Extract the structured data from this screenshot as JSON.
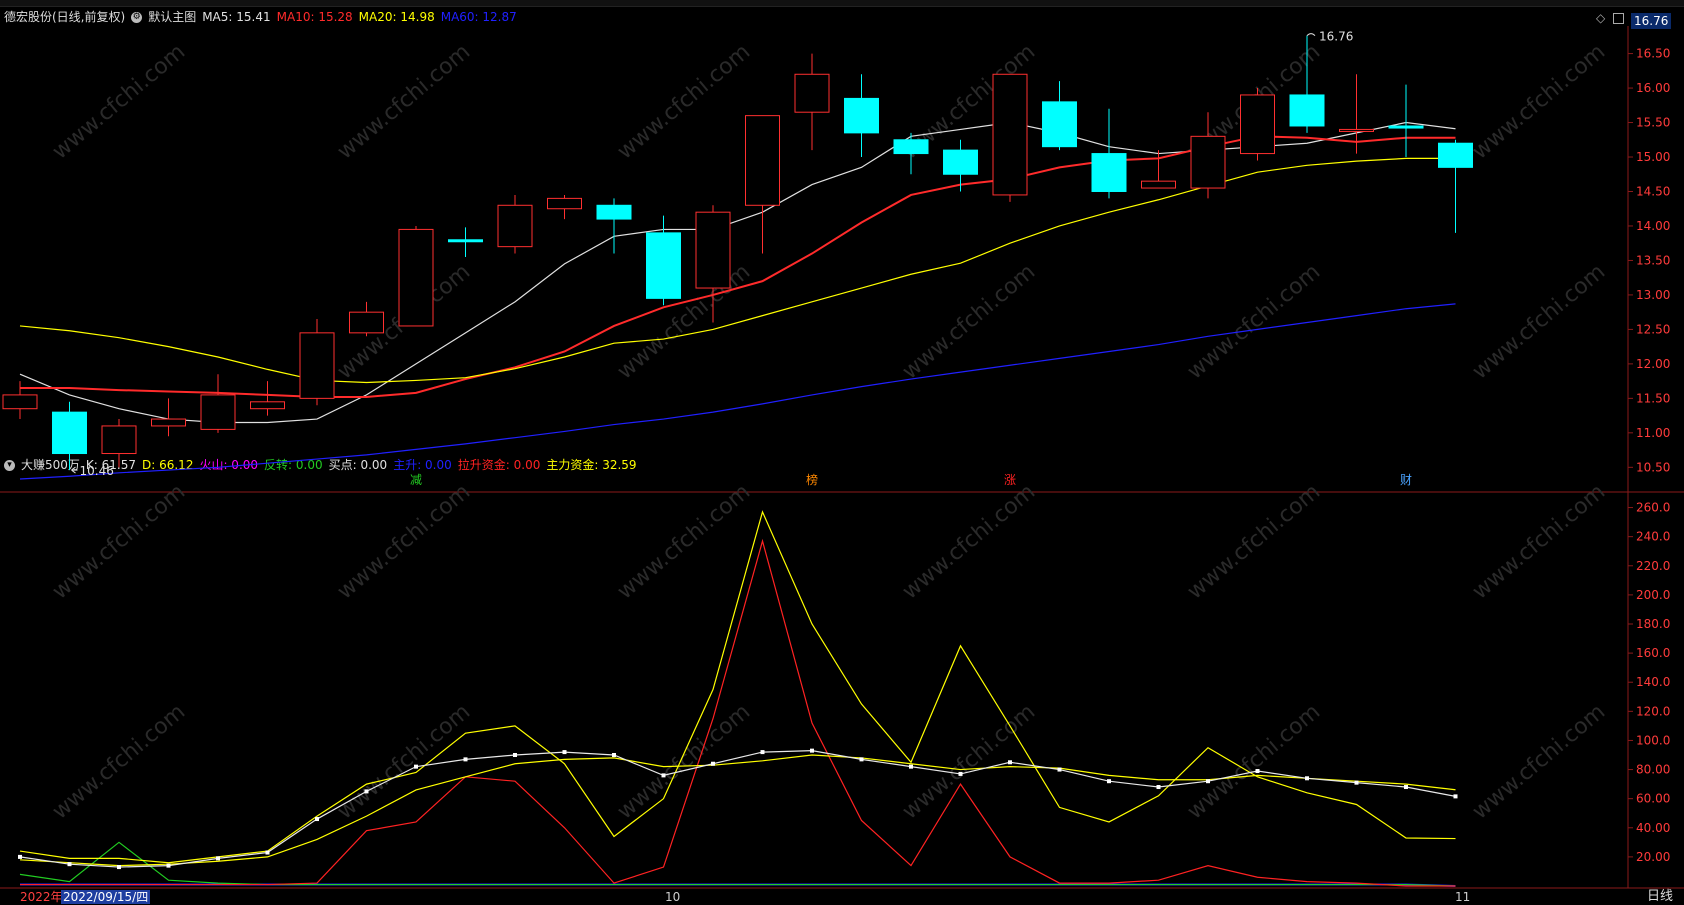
{
  "stock_title": "德宏股份(日线,前复权)",
  "main_chart_name": "默认主图",
  "ma_legend": [
    {
      "label": "MA5: 15.41",
      "color": "#e0e0e0"
    },
    {
      "label": "MA10: 15.28",
      "color": "#ff2b2b"
    },
    {
      "label": "MA20: 14.98",
      "color": "#ffff00"
    },
    {
      "label": "MA60: 12.87",
      "color": "#2020ff"
    }
  ],
  "price_hi_label": "16.76",
  "price_lo_label": "10.46",
  "current_price_badge": "16.76",
  "price_ticks": [
    "16.50",
    "16.00",
    "15.50",
    "15.00",
    "14.50",
    "14.00",
    "13.50",
    "13.00",
    "12.50",
    "12.00",
    "11.50",
    "11.00",
    "10.50"
  ],
  "event_markers": [
    {
      "label": "减",
      "color": "#22cc22"
    },
    {
      "label": "榜",
      "color": "#ff8800"
    },
    {
      "label": "涨",
      "color": "#ff2222"
    },
    {
      "label": "财",
      "color": "#4aa3ff"
    }
  ],
  "indicator_name": "大赚500万",
  "indicator_legend": [
    {
      "label": "K: 61.57",
      "color": "#e0e0e0"
    },
    {
      "label": "D: 66.12",
      "color": "#ffff00"
    },
    {
      "label": "火山: 0.00",
      "color": "#ff00ff"
    },
    {
      "label": "反转: 0.00",
      "color": "#22cc22"
    },
    {
      "label": "买点: 0.00",
      "color": "#e0e0e0"
    },
    {
      "label": "主升: 0.00",
      "color": "#2020ff"
    },
    {
      "label": "拉升资金: 0.00",
      "color": "#ff2222"
    },
    {
      "label": "主力资金: 32.59",
      "color": "#ffff00"
    }
  ],
  "indicator_ticks": [
    "260.0",
    "240.0",
    "220.0",
    "200.0",
    "180.0",
    "160.0",
    "140.0",
    "120.0",
    "100.0",
    "80.00",
    "60.00",
    "40.00",
    "20.00"
  ],
  "x_labels": {
    "year": "2022年",
    "date_cursor": "2022/09/15/四",
    "oct": "10",
    "nov": "11"
  },
  "period_label": "日线",
  "watermark": "www.cfchi.com",
  "chart_data": [
    {
      "type": "candlestick",
      "ylim": [
        10.2,
        16.9
      ],
      "candles": [
        {
          "o": 11.35,
          "c": 11.55,
          "h": 11.75,
          "l": 11.2
        },
        {
          "o": 11.3,
          "c": 10.7,
          "h": 11.45,
          "l": 10.46
        },
        {
          "o": 10.7,
          "c": 11.1,
          "h": 11.2,
          "l": 10.5
        },
        {
          "o": 11.1,
          "c": 11.2,
          "h": 11.5,
          "l": 10.95
        },
        {
          "o": 11.05,
          "c": 11.55,
          "h": 11.85,
          "l": 11.0
        },
        {
          "o": 11.35,
          "c": 11.45,
          "h": 11.75,
          "l": 11.25
        },
        {
          "o": 11.5,
          "c": 12.45,
          "h": 12.65,
          "l": 11.4
        },
        {
          "o": 12.45,
          "c": 12.75,
          "h": 12.9,
          "l": 12.4
        },
        {
          "o": 12.55,
          "c": 13.95,
          "h": 14.0,
          "l": 12.55
        },
        {
          "o": 13.8,
          "c": 13.78,
          "h": 13.98,
          "l": 13.55
        },
        {
          "o": 13.7,
          "c": 14.3,
          "h": 14.45,
          "l": 13.6
        },
        {
          "o": 14.25,
          "c": 14.4,
          "h": 14.45,
          "l": 14.1
        },
        {
          "o": 14.3,
          "c": 14.1,
          "h": 14.4,
          "l": 13.6
        },
        {
          "o": 13.9,
          "c": 12.95,
          "h": 14.15,
          "l": 12.85
        },
        {
          "o": 13.1,
          "c": 14.2,
          "h": 14.3,
          "l": 12.6
        },
        {
          "o": 14.3,
          "c": 15.6,
          "h": 15.6,
          "l": 13.6
        },
        {
          "o": 15.65,
          "c": 16.2,
          "h": 16.5,
          "l": 15.1
        },
        {
          "o": 15.85,
          "c": 15.35,
          "h": 16.2,
          "l": 15.0
        },
        {
          "o": 15.25,
          "c": 15.05,
          "h": 15.35,
          "l": 14.75
        },
        {
          "o": 15.1,
          "c": 14.75,
          "h": 15.25,
          "l": 14.5
        },
        {
          "o": 14.45,
          "c": 16.2,
          "h": 16.2,
          "l": 14.35
        },
        {
          "o": 15.8,
          "c": 15.15,
          "h": 16.1,
          "l": 15.1
        },
        {
          "o": 15.05,
          "c": 14.5,
          "h": 15.7,
          "l": 14.4
        },
        {
          "o": 14.55,
          "c": 14.65,
          "h": 15.1,
          "l": 14.55
        },
        {
          "o": 14.55,
          "c": 15.3,
          "h": 15.65,
          "l": 14.4
        },
        {
          "o": 15.05,
          "c": 15.9,
          "h": 16.0,
          "l": 14.95
        },
        {
          "o": 15.9,
          "c": 15.45,
          "h": 16.76,
          "l": 15.35
        },
        {
          "o": 15.4,
          "c": 15.4,
          "h": 16.2,
          "l": 15.05
        },
        {
          "o": 15.45,
          "c": 15.42,
          "h": 16.05,
          "l": 15.0
        },
        {
          "o": 15.2,
          "c": 14.85,
          "h": 15.25,
          "l": 13.9
        }
      ],
      "series": [
        {
          "name": "MA5",
          "color": "#e0e0e0",
          "values": [
            11.85,
            11.55,
            11.35,
            11.2,
            11.15,
            11.15,
            11.2,
            11.55,
            12.0,
            12.45,
            12.9,
            13.45,
            13.85,
            13.95,
            13.95,
            14.2,
            14.6,
            14.85,
            15.3,
            15.4,
            15.5,
            15.35,
            15.15,
            15.05,
            15.1,
            15.15,
            15.2,
            15.35,
            15.5,
            15.41
          ]
        },
        {
          "name": "MA10",
          "color": "#ff2b2b",
          "values": [
            11.65,
            11.65,
            11.62,
            11.6,
            11.58,
            11.55,
            11.52,
            11.52,
            11.58,
            11.78,
            11.95,
            12.18,
            12.55,
            12.82,
            13.0,
            13.2,
            13.6,
            14.05,
            14.45,
            14.6,
            14.68,
            14.85,
            14.95,
            14.98,
            15.15,
            15.3,
            15.28,
            15.22,
            15.28,
            15.28
          ]
        },
        {
          "name": "MA20",
          "color": "#ffff00",
          "values": [
            12.55,
            12.48,
            12.38,
            12.25,
            12.1,
            11.92,
            11.76,
            11.73,
            11.76,
            11.8,
            11.93,
            12.1,
            12.3,
            12.36,
            12.5,
            12.7,
            12.9,
            13.1,
            13.3,
            13.46,
            13.75,
            14.0,
            14.2,
            14.38,
            14.58,
            14.78,
            14.88,
            14.94,
            14.98,
            14.98
          ]
        },
        {
          "name": "MA60",
          "color": "#2020ff",
          "values": [
            10.33,
            10.37,
            10.42,
            10.46,
            10.5,
            10.56,
            10.62,
            10.68,
            10.76,
            10.84,
            10.93,
            11.02,
            11.12,
            11.2,
            11.3,
            11.42,
            11.55,
            11.67,
            11.78,
            11.88,
            11.98,
            12.08,
            12.18,
            12.28,
            12.4,
            12.5,
            12.6,
            12.7,
            12.8,
            12.87
          ]
        }
      ]
    },
    {
      "type": "line",
      "ylim": [
        0,
        270
      ],
      "series": [
        {
          "name": "K",
          "color": "#e8e8e8",
          "values": [
            20,
            15,
            13,
            14,
            19,
            23,
            46,
            65,
            82,
            87,
            90,
            92,
            90,
            76,
            84,
            92,
            93,
            87,
            82,
            77,
            85,
            80,
            72,
            68,
            72,
            79,
            74,
            71,
            68,
            61.57
          ]
        },
        {
          "name": "D",
          "color": "#ffff00",
          "values": [
            18,
            16,
            14,
            15,
            17,
            20,
            32,
            48,
            66,
            75,
            84,
            87,
            88,
            82,
            83,
            86,
            90,
            88,
            84,
            80,
            82,
            81,
            76,
            73,
            73,
            76,
            74,
            72,
            70,
            66.12
          ]
        },
        {
          "name": "主力资金",
          "color": "#ffff00",
          "values": [
            24,
            19,
            19,
            16,
            20,
            24,
            48,
            70,
            78,
            105,
            110,
            84,
            34,
            60,
            135,
            257,
            180,
            125,
            85,
            165,
            110,
            54,
            44,
            62,
            95,
            75,
            64,
            56,
            33,
            32.59
          ]
        },
        {
          "name": "拉升资金",
          "color": "#ff2222",
          "values": [
            1,
            1,
            1,
            1,
            1,
            1,
            2,
            38,
            44,
            75,
            72,
            40,
            2,
            13,
            115,
            237,
            112,
            45,
            14,
            70,
            20,
            2,
            2,
            4,
            14,
            6,
            3,
            2,
            0,
            0
          ]
        },
        {
          "name": "反转",
          "color": "#22cc22",
          "values": [
            8,
            3,
            30,
            4,
            2,
            1,
            1,
            1,
            1,
            1,
            1,
            1,
            1,
            1,
            1,
            1,
            1,
            1,
            1,
            1,
            1,
            1,
            1,
            1,
            1,
            1,
            1,
            1,
            1,
            0
          ]
        },
        {
          "name": "主升",
          "color": "#2020ff",
          "values": [
            1,
            1,
            1,
            1,
            1,
            1,
            1,
            1,
            1,
            1,
            1,
            1,
            1,
            1,
            1,
            1,
            1,
            1,
            1,
            1,
            1,
            1,
            1,
            1,
            1,
            1,
            1,
            1,
            1,
            0
          ]
        }
      ]
    }
  ]
}
